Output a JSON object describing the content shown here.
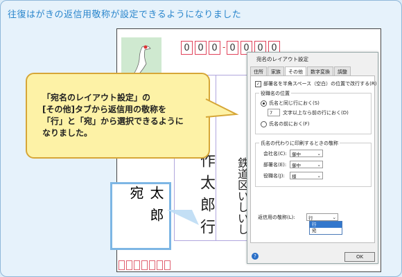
{
  "header": {
    "title": "往復はがきの返信用敬称が設定できるようになりました"
  },
  "postcard": {
    "zip_digits": [
      "0",
      "0",
      "0",
      "0",
      "0",
      "0",
      "0"
    ],
    "zip_dash": "-",
    "name_column": "作太郎行",
    "address_column": "鉄\n道\n区\nい\nし\nい\nし"
  },
  "callout": {
    "text": "「宛名のレイアウト設定」の\n[その他]タブから返信用の敬称を\n「行」と「宛」から選択できるように\nなりました。"
  },
  "zoom": {
    "text": "太郎宛"
  },
  "dialog": {
    "title": "宛名のレイアウト設定",
    "tabs": [
      "住所",
      "家族",
      "その他",
      "数字変換",
      "調整"
    ],
    "active_tab": "その他",
    "option_space_break": "部署名を半角スペース（空白）の位置で改行する(R)",
    "position_group": "役職名の位置",
    "radio_same_line": "氏名と同じ行におく(S)",
    "spin_value": "7",
    "spin_label": "文字以上なら前の行におく(D)",
    "radio_before": "氏名の前におく(F)",
    "honorific_group": "氏名の代わりに印刷するときの敬称",
    "company_label": "会社名(C):",
    "company_value": "御中",
    "department_label": "部署名(E):",
    "department_value": "御中",
    "title_label": "役職名(J):",
    "title_value": "様",
    "reply_label": "返信用の敬称(L):",
    "reply_value": "行",
    "reply_options": [
      "行",
      "宛"
    ],
    "ok_label": "OK",
    "help_label": "?"
  }
}
